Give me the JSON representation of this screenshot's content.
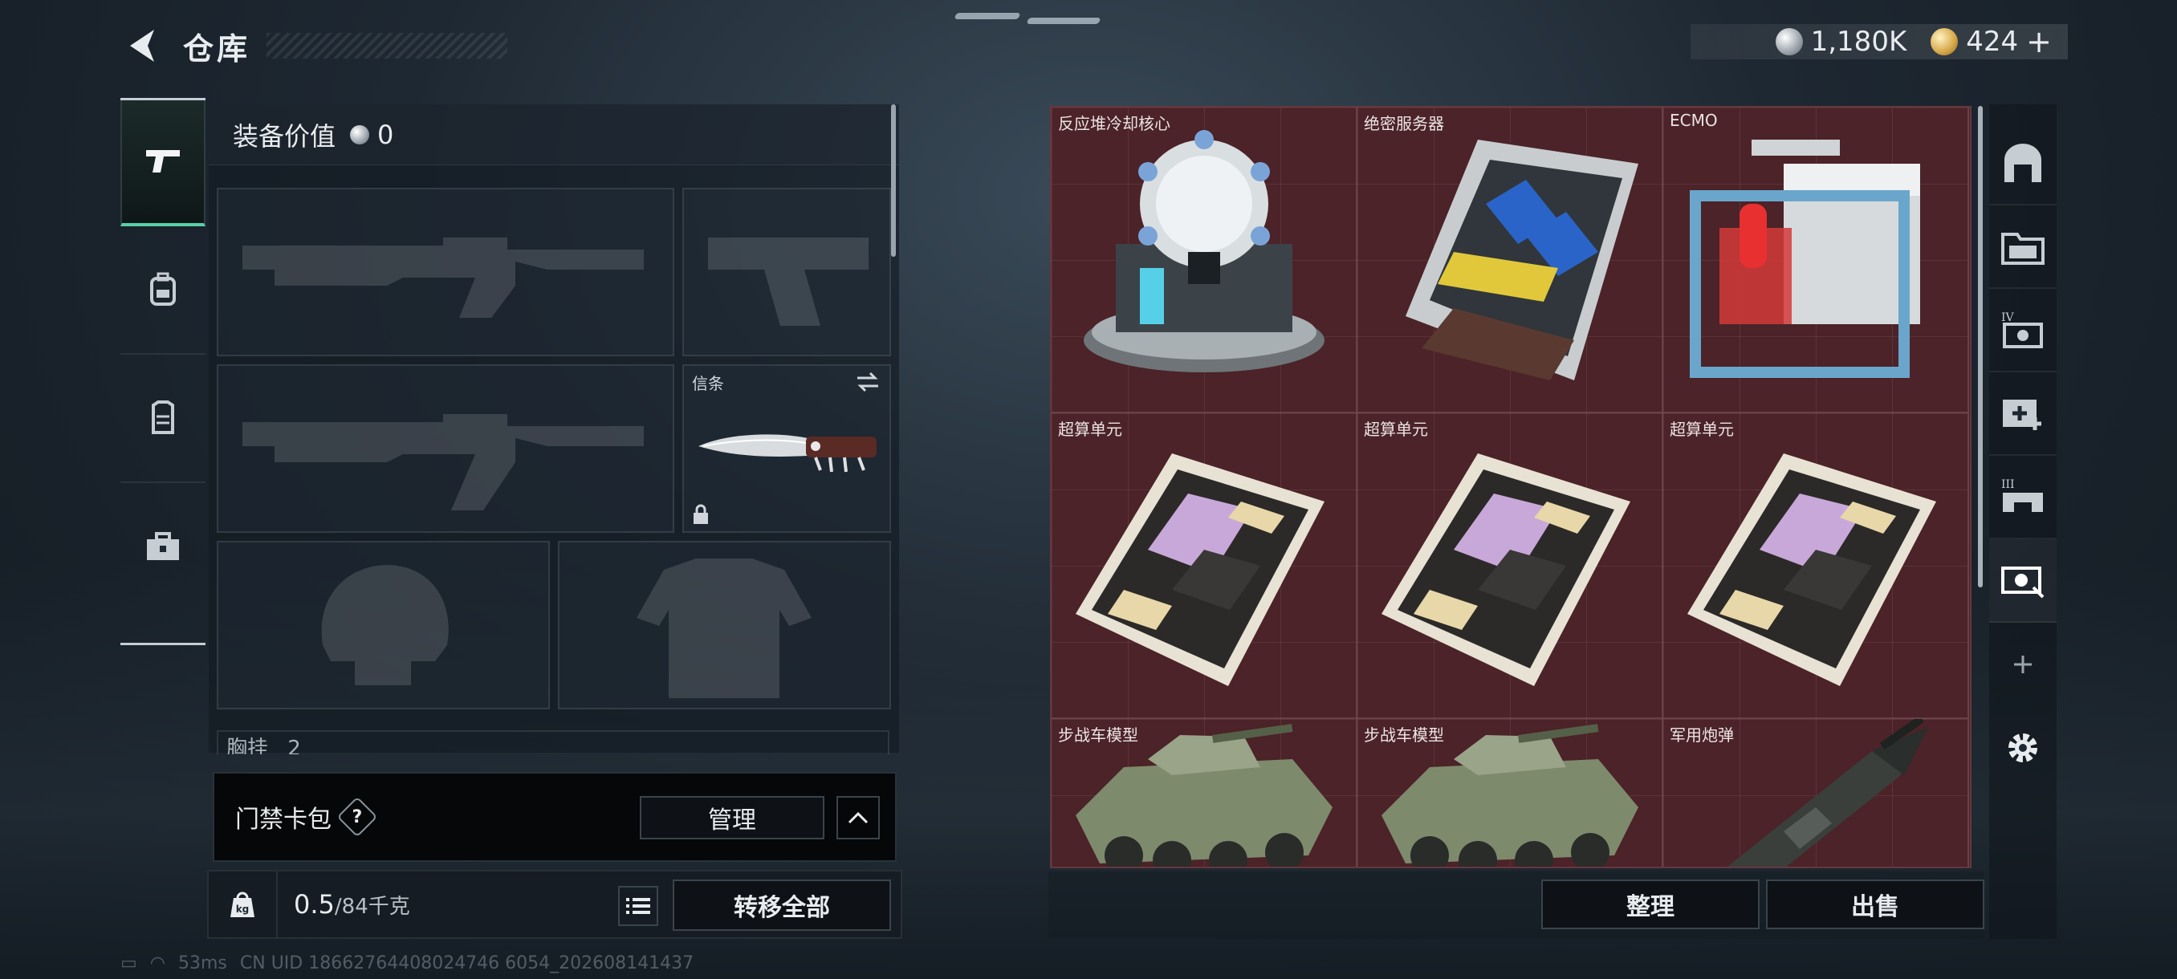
{
  "header": {
    "title": "仓库",
    "currency_silver": "1,180K",
    "currency_gold": "424",
    "plus_label": "+"
  },
  "equipment": {
    "value_label": "装备价值",
    "value": "0",
    "melee_slot_label": "信条",
    "chest_label": "胸挂",
    "chest_count": "2"
  },
  "keycard": {
    "label": "门禁卡包",
    "help": "?",
    "manage_label": "管理"
  },
  "weight": {
    "current": "0.5",
    "max": "/84千克"
  },
  "actions": {
    "transfer_all": "转移全部",
    "sort": "整理",
    "sell": "出售"
  },
  "storage": {
    "items": [
      {
        "name": "反应堆冷却核心"
      },
      {
        "name": "绝密服务器"
      },
      {
        "name": "ECMO"
      },
      {
        "name": "超算单元"
      },
      {
        "name": "超算单元"
      },
      {
        "name": "超算单元"
      },
      {
        "name": "步战车模型"
      },
      {
        "name": "步战车模型"
      },
      {
        "name": "军用炮弹"
      }
    ]
  },
  "status": {
    "ping": "53ms",
    "uid": "CN UID 18662764408024746 6054_202608141437"
  },
  "colors": {
    "accent_green": "#5ad0a8",
    "storage_bg": "#4b2328"
  },
  "icons": {
    "side_tabs": [
      "pistol-icon",
      "backpack-icon",
      "vest-icon",
      "toolbox-icon"
    ],
    "dock": [
      "safehouse-icon",
      "folder-icon",
      "storage-iv-icon",
      "medical-storage-icon",
      "storage-iii-icon",
      "storage-active-icon",
      "add-icon",
      "settings-icon"
    ]
  }
}
